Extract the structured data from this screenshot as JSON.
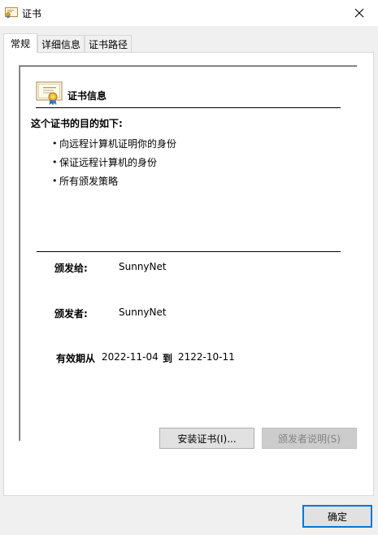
{
  "window": {
    "title": "证书",
    "icon": "certificate-icon"
  },
  "tabs": [
    {
      "label": "常规",
      "active": true
    },
    {
      "label": "详细信息",
      "active": false
    },
    {
      "label": "证书路径",
      "active": false
    }
  ],
  "cert_info": {
    "heading": "证书信息",
    "purpose_heading": "这个证书的目的如下:",
    "purposes": [
      "向远程计算机证明你的身份",
      "保证远程计算机的身份",
      "所有颁发策略"
    ],
    "issued_to_label": "颁发给:",
    "issued_to_value": "SunnyNet",
    "issued_by_label": "颁发者:",
    "issued_by_value": "SunnyNet",
    "validity_label": "有效期从",
    "valid_from": "2022-11-04",
    "to_label": "到",
    "valid_to": "2122-10-11"
  },
  "buttons": {
    "install": "安装证书(I)...",
    "issuer_statement": "颁发者说明(S)",
    "ok": "确定"
  },
  "colors": {
    "accent": "#0078d7",
    "dialog_bg": "#f0f0f0"
  }
}
